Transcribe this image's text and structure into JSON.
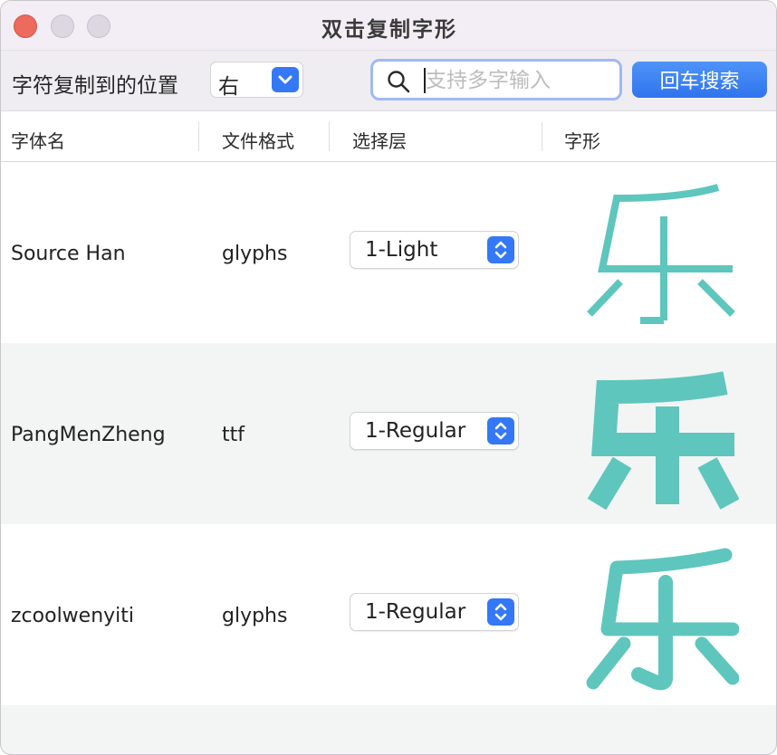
{
  "window": {
    "title": "双击复制字形"
  },
  "toolbar": {
    "location_label": "字符复制到的位置",
    "location_value": "右",
    "search_placeholder": "支持多字输入",
    "search_value": "",
    "search_button": "回车搜索"
  },
  "table": {
    "headers": [
      "字体名",
      "文件格式",
      "选择层",
      "字形"
    ],
    "rows": [
      {
        "font": "Source Han",
        "format": "glyphs",
        "layer": "1-Light",
        "glyph_weight": "light"
      },
      {
        "font": "PangMenZheng",
        "format": "ttf",
        "layer": "1-Regular",
        "glyph_weight": "heavy"
      },
      {
        "font": "zcoolwenyiti",
        "format": "glyphs",
        "layer": "1-Regular",
        "glyph_weight": "regular"
      }
    ]
  },
  "colors": {
    "accent": "#3478f6",
    "glyph": "#5ec6bd",
    "close": "#ed6a5e"
  },
  "icons": {
    "search": "magnifier",
    "select": "chevron-down",
    "layer": "chevron-up-down"
  }
}
